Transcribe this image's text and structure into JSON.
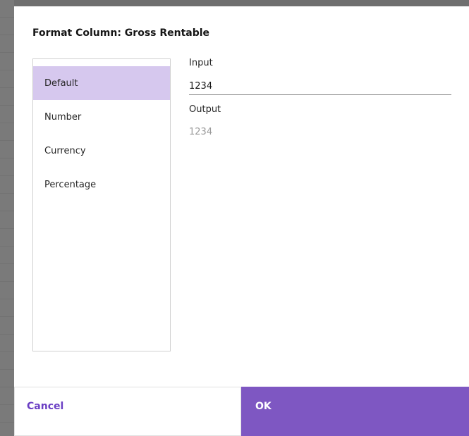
{
  "dialog": {
    "title": "Format Column: Gross Rentable"
  },
  "format_list": {
    "items": [
      {
        "label": "Default",
        "selected": true
      },
      {
        "label": "Number",
        "selected": false
      },
      {
        "label": "Currency",
        "selected": false
      },
      {
        "label": "Percentage",
        "selected": false
      }
    ]
  },
  "input": {
    "label": "Input",
    "value": "1234"
  },
  "output": {
    "label": "Output",
    "value": "1234"
  },
  "footer": {
    "cancel_label": "Cancel",
    "ok_label": "OK"
  },
  "colors": {
    "accent": "#7e57c2",
    "selected_bg": "#d6c8ee",
    "cancel_text": "#6b3fc4"
  }
}
